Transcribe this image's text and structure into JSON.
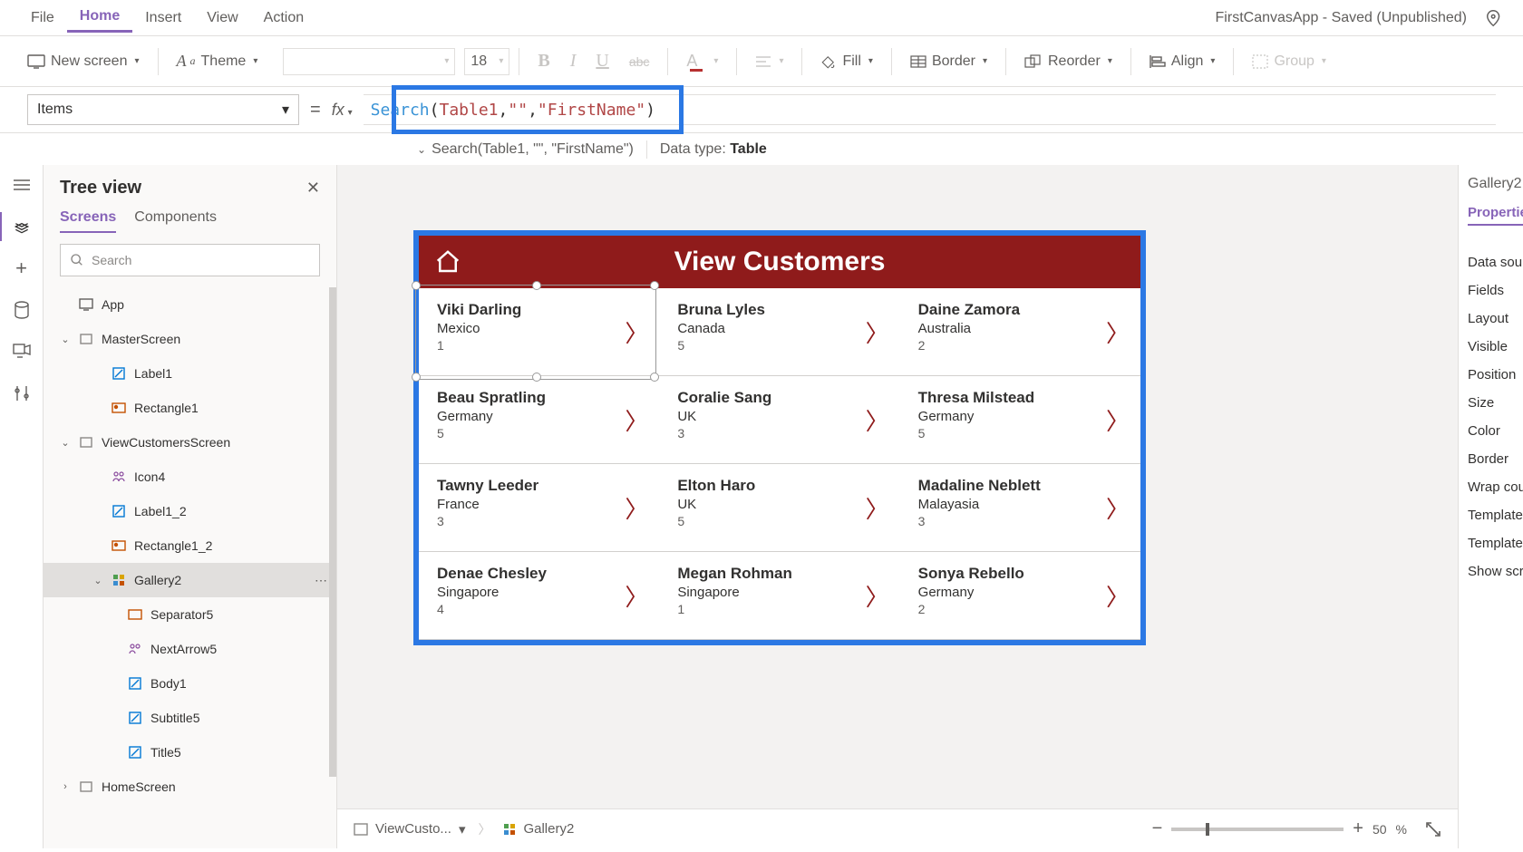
{
  "menubar": {
    "items": [
      "File",
      "Home",
      "Insert",
      "View",
      "Action"
    ],
    "active": "Home",
    "title_status": "FirstCanvasApp - Saved (Unpublished)"
  },
  "ribbon": {
    "new_screen": "New screen",
    "theme": "Theme",
    "font_size": "18",
    "fill": "Fill",
    "border": "Border",
    "reorder": "Reorder",
    "align": "Align",
    "group": "Group"
  },
  "formula": {
    "property": "Items",
    "fx": "fx",
    "tokens": {
      "fn": "Search",
      "open": "(",
      "id": "Table1",
      "c1": ", ",
      "s1": "\"\"",
      "c2": ", ",
      "s2": "\"FirstName\"",
      "close": ")"
    },
    "hint_prefix": "Search(Table1, \"\", \"FirstName\")",
    "datatype_label": "Data type: ",
    "datatype_value": "Table"
  },
  "tree": {
    "title": "Tree view",
    "tabs": [
      "Screens",
      "Components"
    ],
    "active_tab": "Screens",
    "search_placeholder": "Search",
    "nodes": {
      "app": "App",
      "master": "MasterScreen",
      "label1": "Label1",
      "rect1": "Rectangle1",
      "view": "ViewCustomersScreen",
      "icon4": "Icon4",
      "label12": "Label1_2",
      "rect12": "Rectangle1_2",
      "gallery2": "Gallery2",
      "sep5": "Separator5",
      "next5": "NextArrow5",
      "body1": "Body1",
      "sub5": "Subtitle5",
      "title5": "Title5",
      "home": "HomeScreen"
    }
  },
  "app": {
    "header": "View Customers",
    "customers": [
      {
        "name": "Viki  Darling",
        "country": "Mexico",
        "num": "1"
      },
      {
        "name": "Bruna  Lyles",
        "country": "Canada",
        "num": "5"
      },
      {
        "name": "Daine  Zamora",
        "country": "Australia",
        "num": "2"
      },
      {
        "name": "Beau  Spratling",
        "country": "Germany",
        "num": "5"
      },
      {
        "name": "Coralie  Sang",
        "country": "UK",
        "num": "3"
      },
      {
        "name": "Thresa  Milstead",
        "country": "Germany",
        "num": "5"
      },
      {
        "name": "Tawny  Leeder",
        "country": "France",
        "num": "3"
      },
      {
        "name": "Elton  Haro",
        "country": "UK",
        "num": "5"
      },
      {
        "name": "Madaline  Neblett",
        "country": "Malayasia",
        "num": "3"
      },
      {
        "name": "Denae  Chesley",
        "country": "Singapore",
        "num": "4"
      },
      {
        "name": "Megan  Rohman",
        "country": "Singapore",
        "num": "1"
      },
      {
        "name": "Sonya  Rebello",
        "country": "Germany",
        "num": "2"
      }
    ]
  },
  "statusbar": {
    "crumb1": "ViewCusto...",
    "crumb2": "Gallery2",
    "zoom_pct": "50",
    "zoom_unit": "%"
  },
  "right": {
    "heading": "Gallery2",
    "tab": "Properties",
    "rows": [
      "Data source",
      "Fields",
      "Layout",
      "Visible",
      "Position",
      "Size",
      "Color",
      "Border",
      "Wrap count",
      "Template size",
      "Template pa",
      "Show scroll"
    ]
  }
}
